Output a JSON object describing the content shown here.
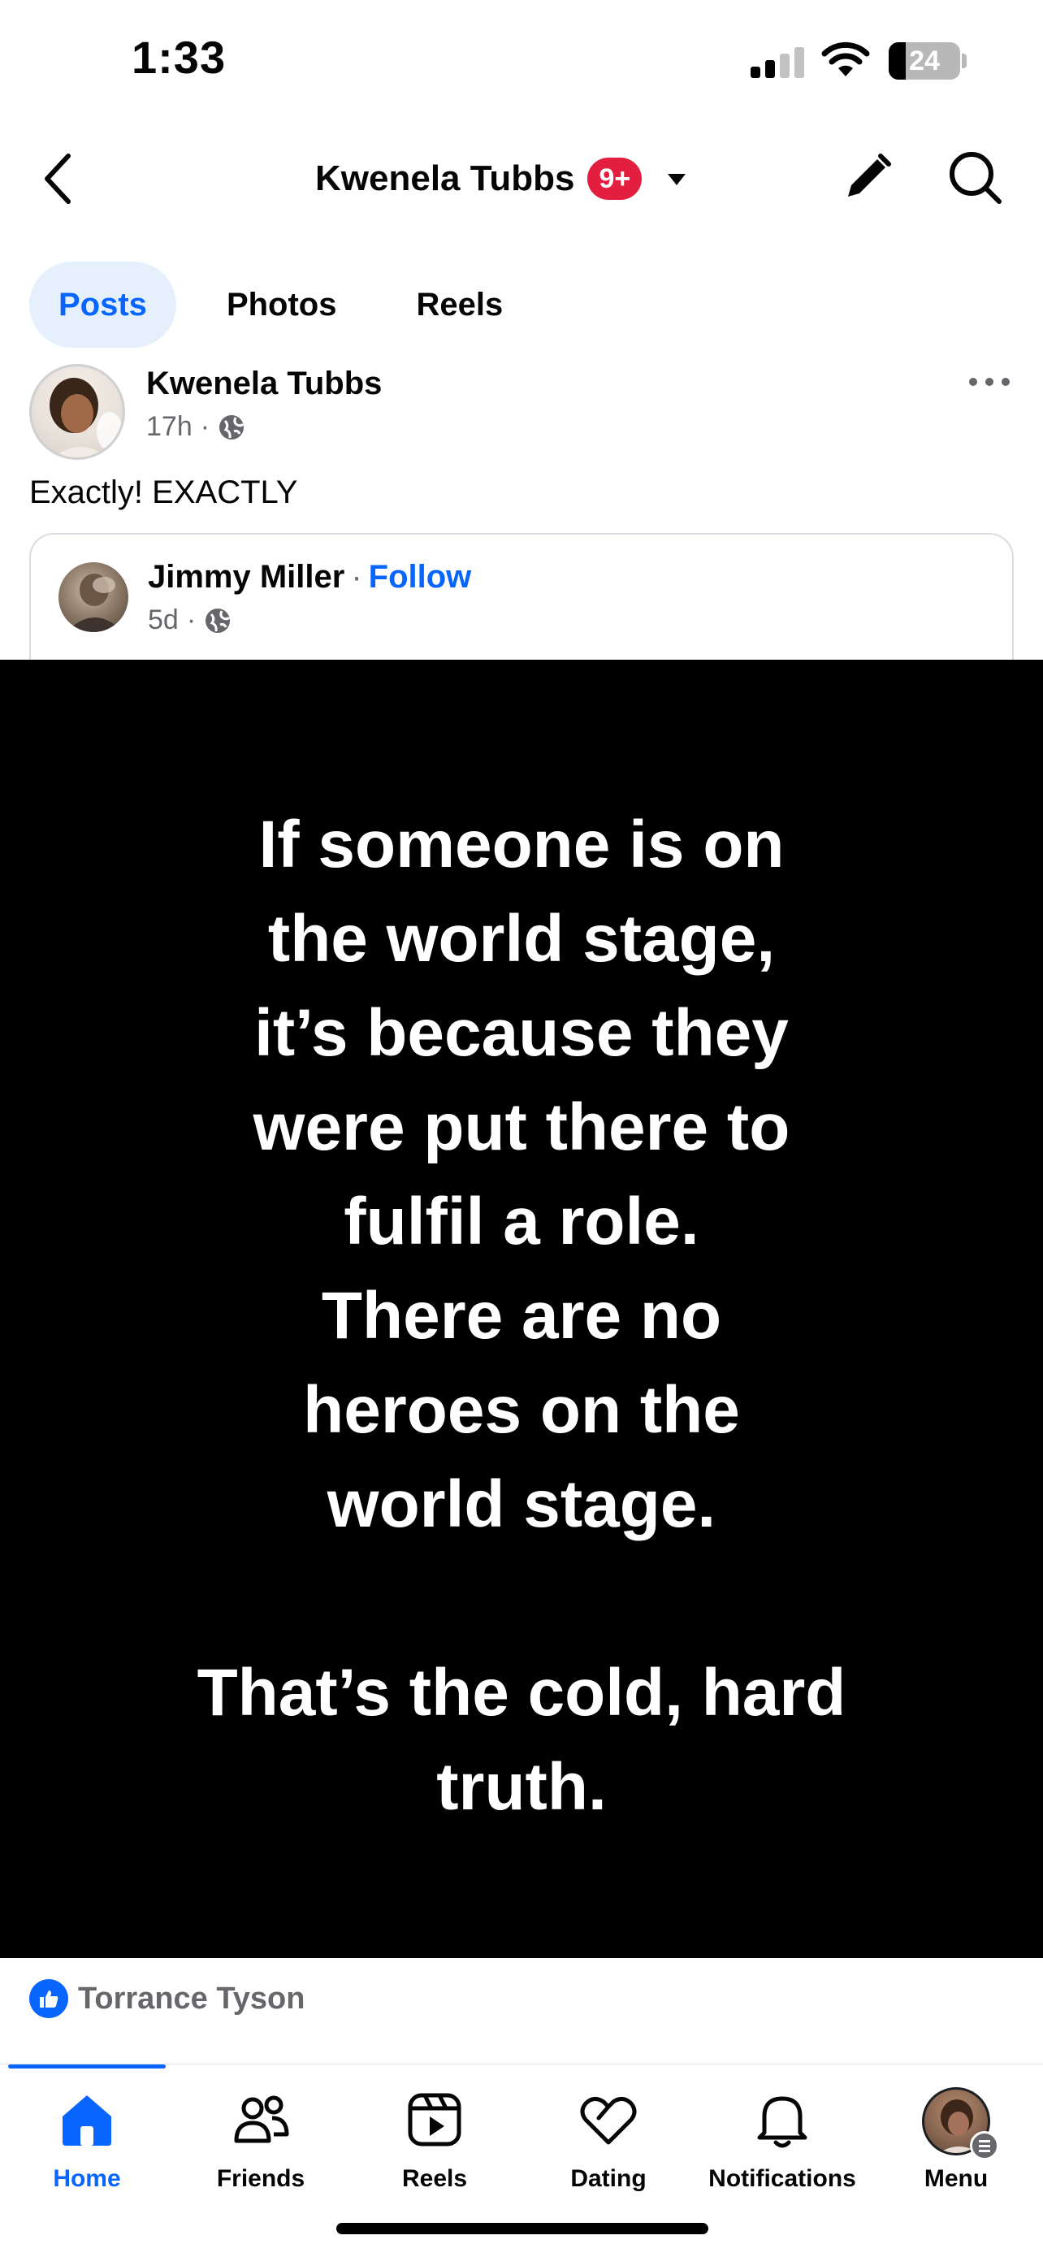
{
  "status_bar": {
    "time": "1:33",
    "battery_percent": "24",
    "battery_level": 0.24
  },
  "header": {
    "title": "Kwenela Tubbs",
    "badge": "9+"
  },
  "tabs": [
    {
      "label": "Posts",
      "active": true
    },
    {
      "label": "Photos",
      "active": false
    },
    {
      "label": "Reels",
      "active": false
    }
  ],
  "post": {
    "author": "Kwenela Tubbs",
    "time": "17h",
    "separator": "·",
    "text": "Exactly! EXACTLY",
    "shared": {
      "author": "Jimmy Miller",
      "follow_label": "Follow",
      "separator": "·",
      "time": "5d",
      "image_text": [
        "If someone is on",
        "the world stage,",
        "it’s because they",
        "were put there to",
        "fulfil a role.",
        "There are no",
        "heroes on the",
        "world stage.",
        "",
        "That’s the cold, hard",
        "truth."
      ]
    },
    "reactions": {
      "first_reactor": "Torrance Tyson"
    }
  },
  "bottom_nav": [
    {
      "label": "Home",
      "icon": "home-icon",
      "active": true
    },
    {
      "label": "Friends",
      "icon": "friends-icon",
      "active": false
    },
    {
      "label": "Reels",
      "icon": "reels-icon",
      "active": false
    },
    {
      "label": "Dating",
      "icon": "dating-icon",
      "active": false
    },
    {
      "label": "Notifications",
      "icon": "bell-icon",
      "active": false
    },
    {
      "label": "Menu",
      "icon": "menu-avatar",
      "active": false
    }
  ],
  "colors": {
    "accent": "#0866ff",
    "badge": "#e41e3f",
    "secondary_text": "#65676b",
    "tab_active_bg": "#e6f0fc"
  }
}
